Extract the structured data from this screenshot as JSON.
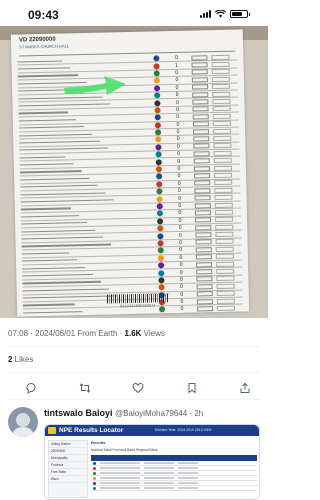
{
  "status_bar": {
    "time": "09:43"
  },
  "photo": {
    "ballot_title": "VD 22090000",
    "ballot_subtitle": "ST MARKS CHURCH HALL",
    "barcode_number": "0212242090203011",
    "row_vote_marks": [
      "0",
      "1",
      "0",
      "0",
      "0",
      "0",
      "0",
      "0",
      "0",
      "0",
      "0",
      "0",
      "0",
      "0",
      "0",
      "0",
      "0",
      "0",
      "0",
      "0",
      "0",
      "0",
      "0",
      "0",
      "0",
      "0",
      "0",
      "0",
      "0",
      "0",
      "0",
      "0",
      "0",
      "0",
      "0"
    ],
    "arrow_color": "#4fe06b"
  },
  "tweet": {
    "timestamp": "07:08 · 2024/06/01 From Earth · ",
    "views_count": "1.6K",
    "views_label": " Views",
    "likes_count": "2",
    "likes_label": " Likes"
  },
  "actions": {
    "reply_icon": "reply-icon",
    "retweet_icon": "retweet-icon",
    "like_icon": "heart-icon",
    "bookmark_icon": "bookmark-icon",
    "share_icon": "share-icon"
  },
  "reply": {
    "display_name": "tintswalo Baloyi",
    "handle": "@BaloyiMoha79644",
    "time": " · 2h",
    "image": {
      "app_title": "NPE Results Locator",
      "elections_label": "Election Year:  2024   2019   2014   2009",
      "results_label": "Results",
      "ballot_options": "National Ballot   Provincial Ballot   Regional Ballot",
      "side_rows": [
        "Voting District",
        "22090000",
        "Municipality",
        "Province",
        "Free State",
        "Ward"
      ]
    }
  },
  "colors": {
    "accent": "#1d9bf0",
    "npe_blue": "#1b3f8b",
    "muted_text": "#536471"
  }
}
